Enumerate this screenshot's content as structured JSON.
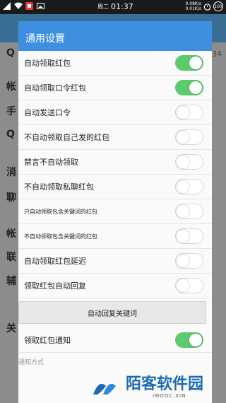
{
  "status_bar": {
    "day": "周二",
    "time": "01:37",
    "net_up": "0.08K/s",
    "net_down": "0.01K/s",
    "battery": "100"
  },
  "background": {
    "items": [
      "Q",
      "帐",
      "手",
      "Q",
      "消",
      "聊",
      "帐",
      "联",
      "辅",
      "关"
    ],
    "right_value": "34"
  },
  "dialog": {
    "title": "通用设置",
    "rows": [
      {
        "label": "自动领取红包",
        "on": true
      },
      {
        "label": "自动领取口令红包",
        "on": true
      },
      {
        "label": "自动发送口令",
        "on": false
      },
      {
        "label": "不自动领取自己发的红包",
        "on": false
      },
      {
        "label": "禁言不自动领取",
        "on": false
      },
      {
        "label": "不自动领取私聊红包",
        "on": false
      },
      {
        "label": "只自动领取包含关键词的红包",
        "on": false
      },
      {
        "label": "不自动领取包含关键词的红包",
        "on": false
      },
      {
        "label": "自动领取红包延迟",
        "on": false
      },
      {
        "label": "领取红包自动回复",
        "on": false
      }
    ],
    "reply_keywords_button": "自动回复关键词",
    "notify_row": {
      "label": "领取红包通知",
      "on": true
    },
    "notify_method_label": "通知方式"
  },
  "watermark": {
    "main": "陌客软件园",
    "sub": "IMOOC.XIN"
  },
  "colors": {
    "accent": "#3f8fe0",
    "toggle_on": "#5ccb6e"
  }
}
